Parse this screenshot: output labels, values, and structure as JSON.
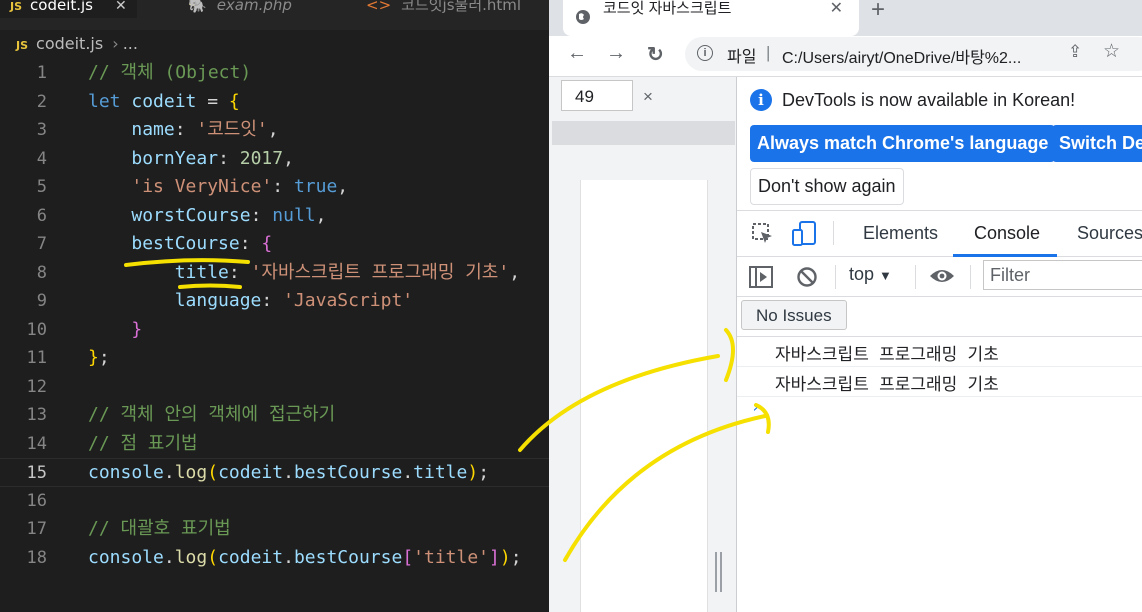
{
  "editor": {
    "tabs": [
      {
        "label": "codeit.js",
        "active": true
      },
      {
        "label": "exam.php",
        "active": false
      },
      {
        "label": "코드잇js불러.html",
        "active": false
      }
    ],
    "breadcrumb": {
      "file": "codeit.js",
      "more": "..."
    },
    "line_numbers": [
      "1",
      "2",
      "3",
      "4",
      "5",
      "6",
      "7",
      "8",
      "9",
      "10",
      "11",
      "12",
      "13",
      "14",
      "15",
      "16",
      "17",
      "18"
    ],
    "current_line": "15"
  },
  "browser": {
    "tab_title": "코드잇 자바스크립트",
    "new_tab": "+",
    "back": "←",
    "forward": "→",
    "reload": "↻",
    "omnibox_label": "파일",
    "omnibox_sep": "|",
    "url": "C:/Users/airyt/OneDrive/바탕%2...",
    "device_dim": "49",
    "device_x": "×",
    "devtools": {
      "notice_text": "DevTools is now available in Korean!",
      "btn_match": "Always match Chrome's language",
      "btn_switch": "Switch De",
      "btn_dont_show": "Don't show again",
      "tabs": [
        "Elements",
        "Console",
        "Sources"
      ],
      "active_tab": "Console",
      "context": "top",
      "filter_placeholder": "Filter",
      "issues": "No Issues",
      "console_logs": [
        "자바스크립트 프로그래밍 기초",
        "자바스크립트 프로그래밍 기초"
      ],
      "prompt": "›"
    }
  },
  "colors": {
    "annotation": "#f5e000",
    "accent": "#1a73e8",
    "editor_bg": "#1e1e1e"
  }
}
